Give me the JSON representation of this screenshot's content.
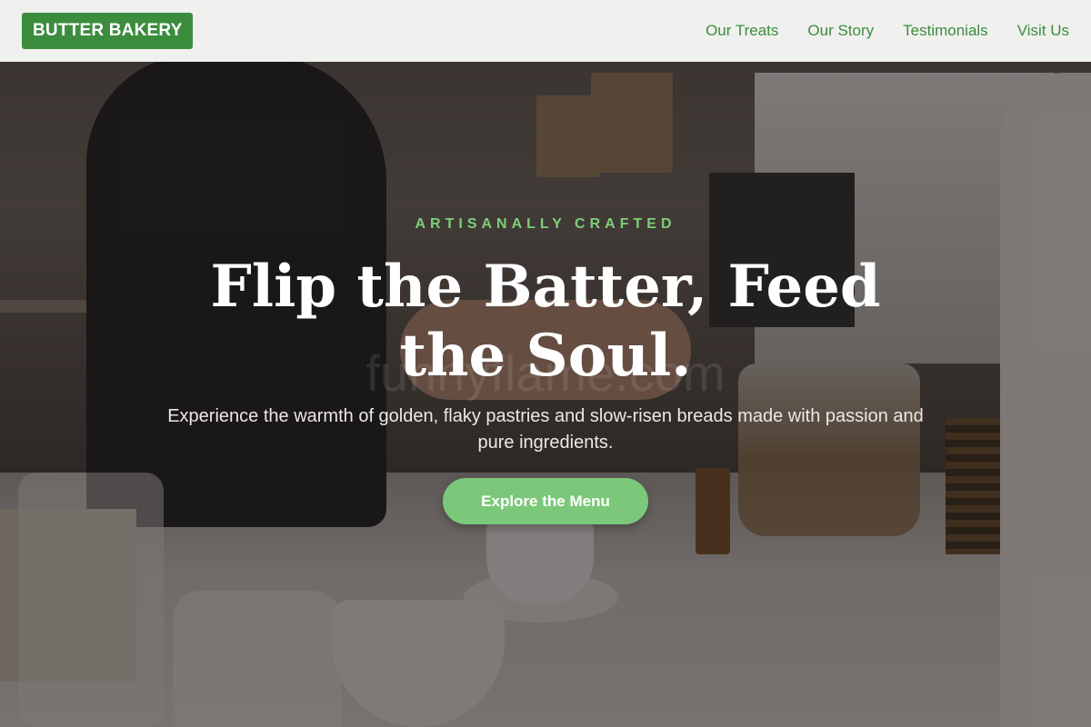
{
  "nav": {
    "brand": "BUTTER BAKERY",
    "links": [
      "Our Treats",
      "Our Story",
      "Testimonials",
      "Visit Us"
    ]
  },
  "hero": {
    "eyebrow": "ARTISANALLY CRAFTED",
    "headline": "Flip the Batter, Feed the Soul.",
    "subtext": "Experience the warmth of golden, flaky pastries and slow-risen breads made with passion and pure ingredients.",
    "cta_label": "Explore the Menu",
    "watermark": "funnyflame.com"
  },
  "colors": {
    "brand_green": "#3c8c3e",
    "accent_green": "#7cc87a",
    "eyebrow_green": "#7ccf7a"
  }
}
